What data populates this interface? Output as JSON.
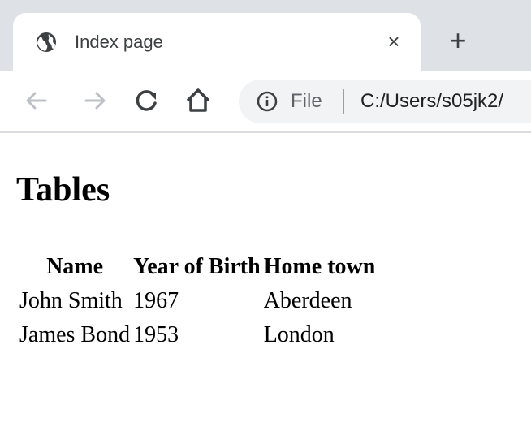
{
  "browser": {
    "tab": {
      "title": "Index page",
      "close_glyph": "×"
    },
    "new_tab_glyph": "+",
    "address_bar": {
      "scheme_label": "File",
      "url": "C:/Users/s05jk2/",
      "info_icon": "info-icon"
    },
    "nav_icons": [
      "back-arrow-icon",
      "forward-arrow-icon",
      "reload-icon",
      "home-icon"
    ]
  },
  "page": {
    "heading": "Tables",
    "table": {
      "headers": [
        "Name",
        "Year of Birth",
        "Home town"
      ],
      "rows": [
        [
          "John Smith",
          "1967",
          "Aberdeen"
        ],
        [
          "James Bond",
          "1953",
          "London"
        ]
      ]
    }
  }
}
